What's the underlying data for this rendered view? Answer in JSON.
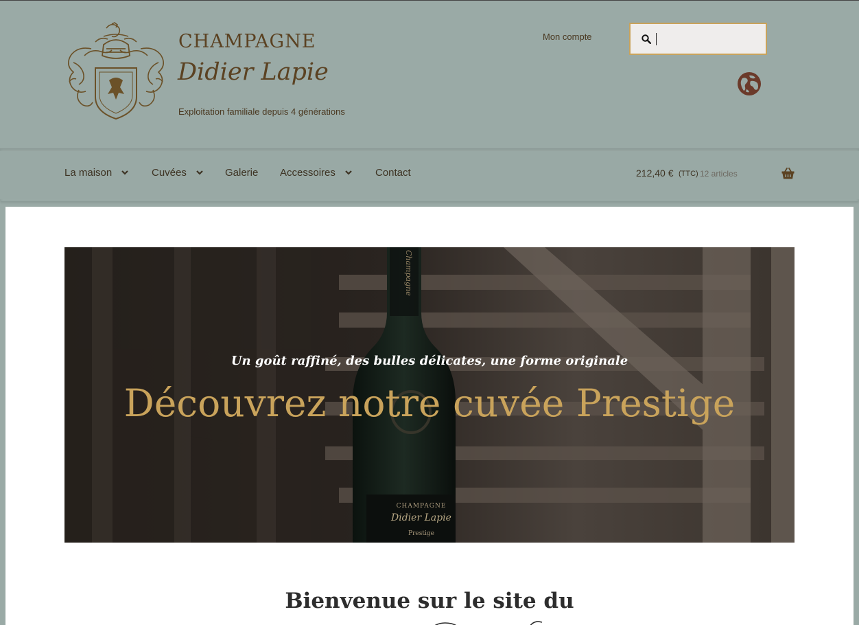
{
  "brand": {
    "line1": "CHAMPAGNE",
    "line2": "Didier Lapie",
    "tagline": "Exploitation familiale depuis 4 générations"
  },
  "header": {
    "account_label": "Mon compte",
    "search_value": ""
  },
  "nav": {
    "items": [
      {
        "label": "La maison",
        "has_dropdown": true
      },
      {
        "label": "Cuvées",
        "has_dropdown": true
      },
      {
        "label": "Galerie",
        "has_dropdown": false
      },
      {
        "label": "Accessoires",
        "has_dropdown": true
      },
      {
        "label": "Contact",
        "has_dropdown": false
      }
    ]
  },
  "cart": {
    "amount": "212,40 €",
    "ttc": "(TTC)",
    "count": "12 articles"
  },
  "hero": {
    "subtitle": "Un goût raffiné, des bulles délicates, une forme originale",
    "title": "Découvrez notre cuvée Prestige",
    "label_champagne": "CHAMPAGNE",
    "label_name": "Didier Lapie",
    "label_cuvee": "Prestige",
    "neck_label": "Champagne"
  },
  "welcome": {
    "text": "Bienvenue sur le site du"
  },
  "colors": {
    "header_bg": "#9aaaa6",
    "brand_brown": "#5b4222",
    "gold": "#c9a35b",
    "globe": "#6b3a2a"
  },
  "icons": {
    "search": "search-icon",
    "globe": "globe-icon",
    "cart": "basket-icon",
    "chevron": "chevron-down-icon",
    "crest": "coat-of-arms-logo"
  }
}
